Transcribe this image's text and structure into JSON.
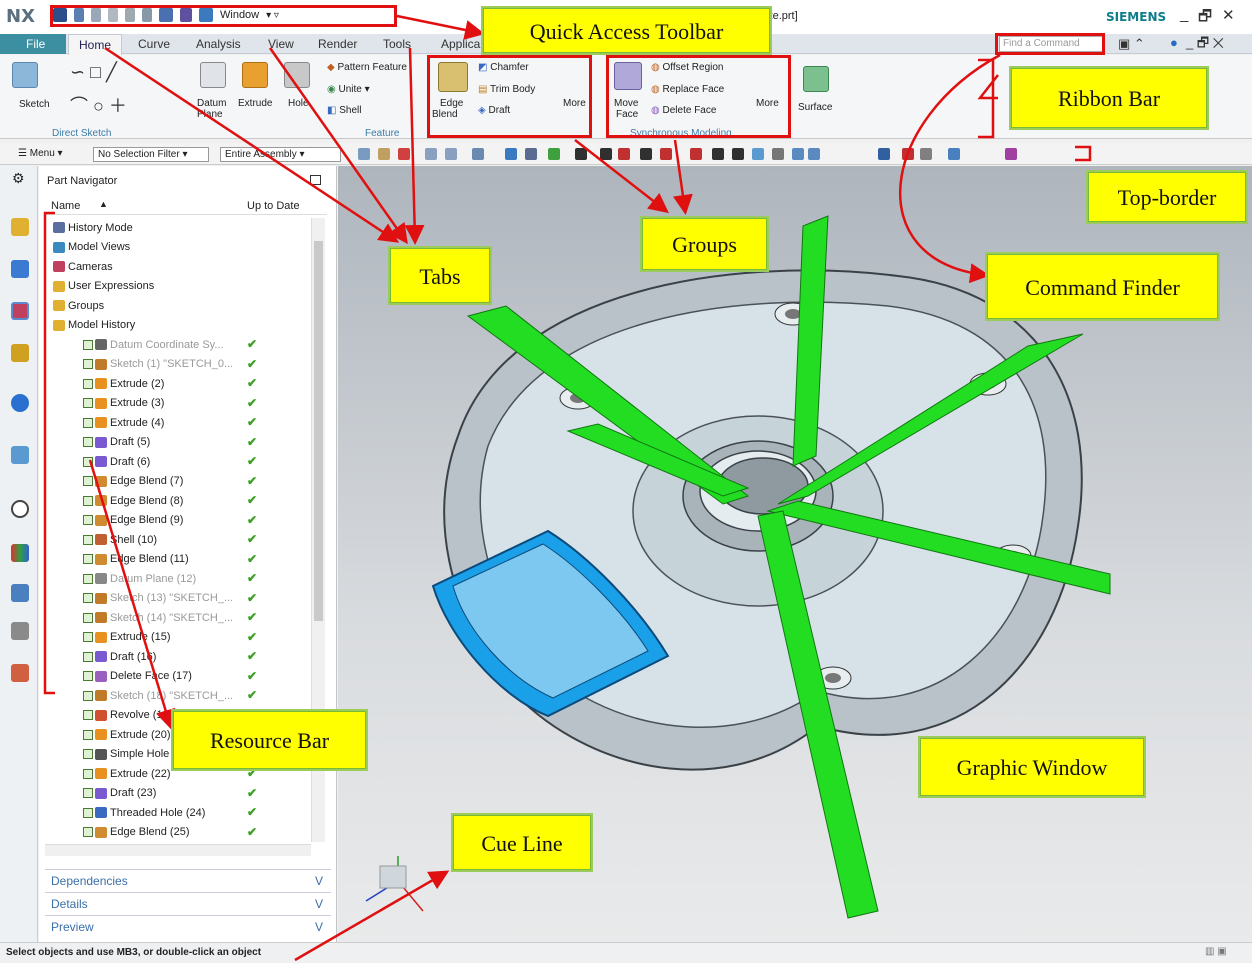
{
  "app": {
    "logo": "NX",
    "window_title": "or unite.prt]",
    "brand": "SIEMENS",
    "window_menu": "Window"
  },
  "tabs": {
    "file": "File",
    "items": [
      "Home",
      "Curve",
      "Analysis",
      "View",
      "Render",
      "Tools",
      "Applica"
    ]
  },
  "command_finder": {
    "placeholder": "Find a Command"
  },
  "ribbon": {
    "direct_sketch": {
      "sketch": "Sketch",
      "group": "Direct Sketch"
    },
    "feature": {
      "datum": "Datum",
      "datum2": "Plane",
      "extrude": "Extrude",
      "hole": "Hole",
      "pattern": "Pattern Feature",
      "unite": "Unite",
      "shell": "Shell",
      "group": "Feature"
    },
    "blend": {
      "edge": "Edge",
      "blend": "Blend",
      "chamfer": "Chamfer",
      "trim": "Trim Body",
      "draft": "Draft",
      "more": "More"
    },
    "sync": {
      "move": "Move",
      "face": "Face",
      "offset": "Offset Region",
      "replace": "Replace Face",
      "delete": "Delete Face",
      "more": "More",
      "group": "Synchronous Modeling"
    },
    "surface": "Surface"
  },
  "topborder": {
    "menu": "Menu",
    "filter": "No Selection Filter",
    "scope": "Entire Assembly"
  },
  "navigator": {
    "title": "Part Navigator",
    "col_name": "Name",
    "col_status": "Up to Date",
    "rows": [
      {
        "label": "History Mode",
        "tick": ""
      },
      {
        "label": "Model Views",
        "tick": ""
      },
      {
        "label": "Cameras",
        "tick": ""
      },
      {
        "label": "User Expressions",
        "tick": ""
      },
      {
        "label": "Groups",
        "tick": ""
      },
      {
        "label": "Model History",
        "tick": ""
      },
      {
        "label": "Datum Coordinate Sy...",
        "tick": "✔"
      },
      {
        "label": "Sketch (1) \"SKETCH_0...",
        "tick": "✔"
      },
      {
        "label": "Extrude (2)",
        "tick": "✔"
      },
      {
        "label": "Extrude (3)",
        "tick": "✔"
      },
      {
        "label": "Extrude (4)",
        "tick": "✔"
      },
      {
        "label": "Draft (5)",
        "tick": "✔"
      },
      {
        "label": "Draft (6)",
        "tick": "✔"
      },
      {
        "label": "Edge Blend (7)",
        "tick": "✔"
      },
      {
        "label": "Edge Blend (8)",
        "tick": "✔"
      },
      {
        "label": "Edge Blend (9)",
        "tick": "✔"
      },
      {
        "label": "Shell (10)",
        "tick": "✔"
      },
      {
        "label": "Edge Blend (11)",
        "tick": "✔"
      },
      {
        "label": "Datum Plane (12)",
        "tick": "✔"
      },
      {
        "label": "Sketch (13) \"SKETCH_...",
        "tick": "✔"
      },
      {
        "label": "Sketch (14) \"SKETCH_...",
        "tick": "✔"
      },
      {
        "label": "Extrude (15)",
        "tick": "✔"
      },
      {
        "label": "Draft (16)",
        "tick": "✔"
      },
      {
        "label": "Delete Face (17)",
        "tick": "✔"
      },
      {
        "label": "Sketch (18) \"SKETCH_...",
        "tick": "✔"
      },
      {
        "label": "Revolve (19)",
        "tick": "✔"
      },
      {
        "label": "Extrude (20)",
        "tick": "✔"
      },
      {
        "label": "Simple Hole (21)",
        "tick": "✔"
      },
      {
        "label": "Extrude (22)",
        "tick": "✔"
      },
      {
        "label": "Draft (23)",
        "tick": "✔"
      },
      {
        "label": "Threaded Hole (24)",
        "tick": "✔"
      },
      {
        "label": "Edge Blend (25)",
        "tick": "✔"
      }
    ],
    "panels": [
      "Dependencies",
      "Details",
      "Preview"
    ]
  },
  "status": "Select objects and use MB3, or double-click an object",
  "callouts": {
    "qat": "Quick Access Toolbar",
    "ribbon": "Ribbon Bar",
    "topborder": "Top-border",
    "groups": "Groups",
    "tabs": "Tabs",
    "cmdfinder": "Command Finder",
    "resbar": "Resource Bar",
    "gfx": "Graphic Window",
    "cue": "Cue Line"
  },
  "colors": {
    "accent": "#3b8fa0",
    "annotation": "#e01010",
    "callout_bg": "#ffff00",
    "part_green": "#22dd22",
    "part_blue": "#1aa0e8"
  }
}
